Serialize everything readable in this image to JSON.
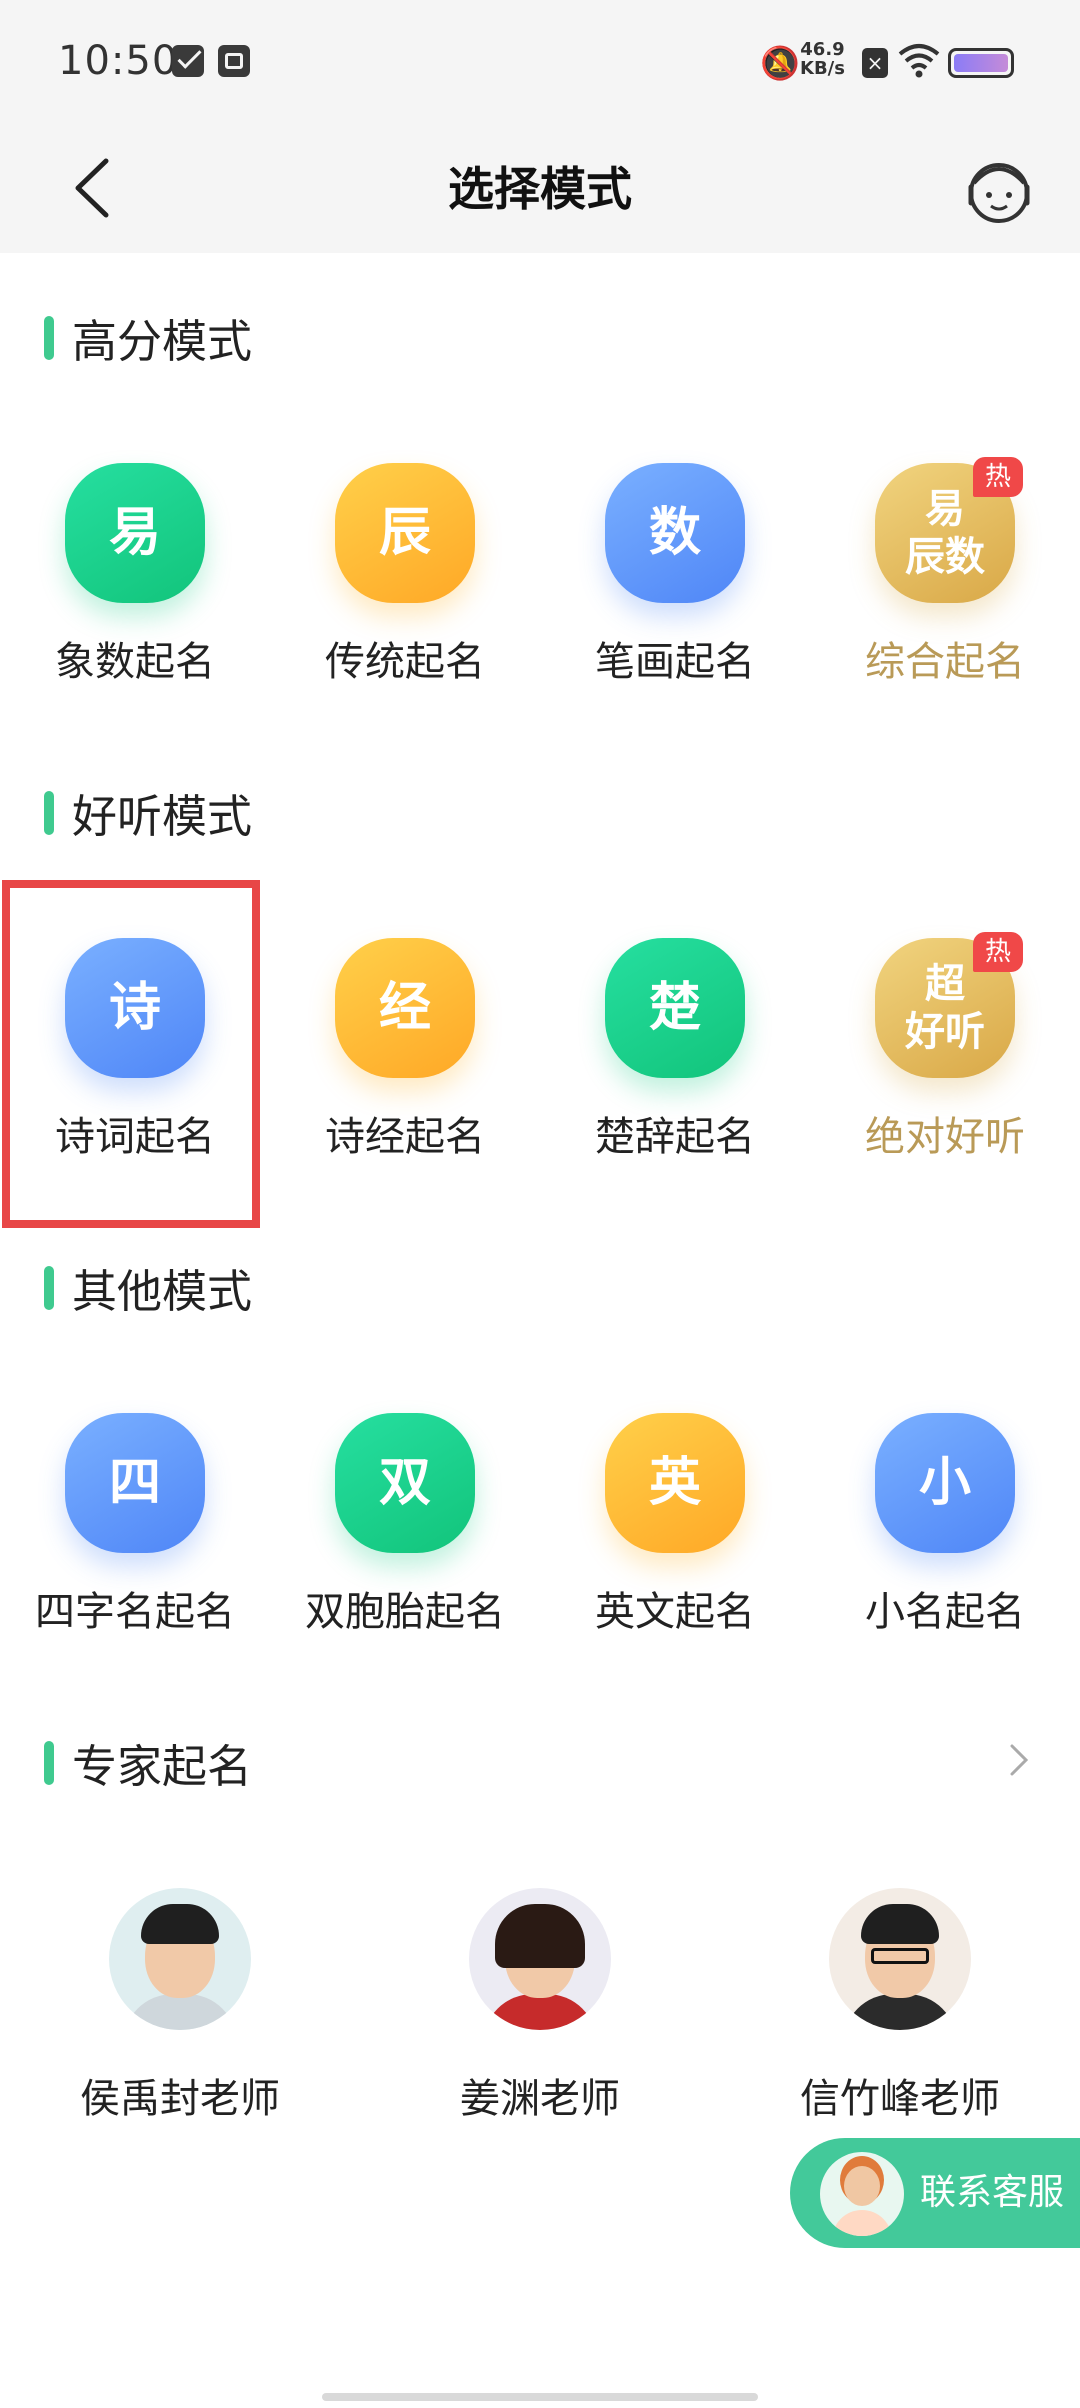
{
  "status_bar": {
    "time": "10:50",
    "net_speed_value": "46.9",
    "net_speed_unit": "KB/s"
  },
  "header": {
    "title": "选择模式"
  },
  "sections": {
    "high_score": {
      "title": "高分模式",
      "items": [
        {
          "icon_text": "易",
          "label": "象数起名",
          "color": "green"
        },
        {
          "icon_text": "辰",
          "label": "传统起名",
          "color": "orange"
        },
        {
          "icon_text": "数",
          "label": "笔画起名",
          "color": "blue"
        },
        {
          "icon_text_1": "易",
          "icon_text_2": "辰数",
          "label": "综合起名",
          "color": "gold",
          "badge": "热"
        }
      ]
    },
    "pleasant": {
      "title": "好听模式",
      "items": [
        {
          "icon_text": "诗",
          "label": "诗词起名",
          "color": "blue",
          "selected": true
        },
        {
          "icon_text": "经",
          "label": "诗经起名",
          "color": "orange"
        },
        {
          "icon_text": "楚",
          "label": "楚辞起名",
          "color": "green"
        },
        {
          "icon_text_1": "超",
          "icon_text_2": "好听",
          "label": "绝对好听",
          "color": "gold",
          "badge": "热"
        }
      ]
    },
    "other": {
      "title": "其他模式",
      "items": [
        {
          "icon_text": "四",
          "label": "四字名起名",
          "color": "blue"
        },
        {
          "icon_text": "双",
          "label": "双胞胎起名",
          "color": "green"
        },
        {
          "icon_text": "英",
          "label": "英文起名",
          "color": "orange"
        },
        {
          "icon_text": "小",
          "label": "小名起名",
          "color": "blue"
        }
      ]
    },
    "experts": {
      "title": "专家起名",
      "items": [
        {
          "name": "侯禹封老师"
        },
        {
          "name": "姜渊老师"
        },
        {
          "name": "信竹峰老师"
        }
      ]
    }
  },
  "contact_button": {
    "label": "联系客服"
  },
  "colors": {
    "accent_green": "#3fca8f",
    "highlight_red": "#e84646",
    "gold_label": "#b99a57"
  }
}
